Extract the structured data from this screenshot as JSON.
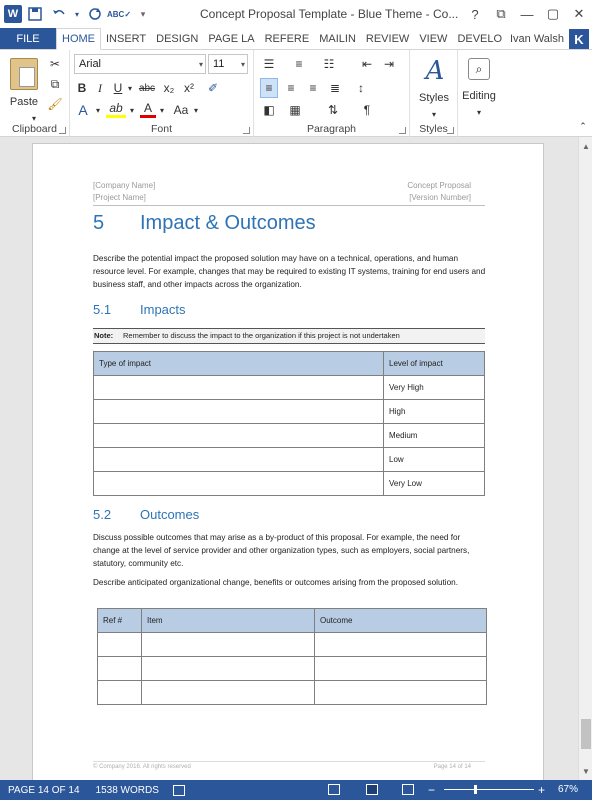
{
  "window": {
    "title": "Concept Proposal Template - Blue Theme - Co...",
    "help": "?",
    "restore": "▢",
    "minimize": "—",
    "close": "✕"
  },
  "qat": {
    "logo": "W",
    "save_icon": "save-icon",
    "undo_icon": "undo-icon",
    "redo_icon": "redo-icon",
    "spelling_icon": "spelling-icon",
    "customize_icon": "customize-icon"
  },
  "tabs": [
    "FILE",
    "HOME",
    "INSERT",
    "DESIGN",
    "PAGE LA",
    "REFERE",
    "MAILIN",
    "REVIEW",
    "VIEW",
    "DEVELO"
  ],
  "user": {
    "name": "Ivan Walsh",
    "initial": "K"
  },
  "ribbon": {
    "clipboard": {
      "label": "Clipboard",
      "paste": "Paste"
    },
    "font": {
      "label": "Font",
      "font_name": "Arial",
      "font_size": "11",
      "bold": "B",
      "italic": "I",
      "underline": "U",
      "strike": "abc",
      "subscript": "x₂",
      "superscript": "x²",
      "grow": "A",
      "case": "Aa",
      "highlight": "ab",
      "color": "A"
    },
    "paragraph": {
      "label": "Paragraph",
      "pilcrow": "¶"
    },
    "styles": {
      "label": "Styles",
      "button": "Styles"
    },
    "editing": {
      "button": "Editing"
    }
  },
  "document": {
    "header_left": [
      "[Company Name]",
      "[Project Name]"
    ],
    "header_right": [
      "Concept Proposal",
      "[Version Number]"
    ],
    "h1_num": "5",
    "h1_text": "Impact & Outcomes",
    "intro": "Describe the potential impact the proposed solution may have on a technical, operations, and human resource level. For example, changes that may be required to existing IT systems, training for end users and business staff, and other impacts across the organization.",
    "h2a_num": "5.1",
    "h2a_text": "Impacts",
    "note_label": "Note:",
    "note_text": "Remember to discuss the impact to the organization if this project is not undertaken",
    "impact_table": {
      "headers": [
        "Type of impact",
        "Level of impact"
      ],
      "rows": [
        [
          "",
          "Very High"
        ],
        [
          "",
          "High"
        ],
        [
          "",
          "Medium"
        ],
        [
          "",
          "Low"
        ],
        [
          "",
          "Very Low"
        ]
      ]
    },
    "h2b_num": "5.2",
    "h2b_text": "Outcomes",
    "outcomes_p1": "Discuss possible outcomes that may arise as a by-product of this proposal. For example, the need for change at the level of service provider and other organization types, such as employers, social partners, statutory, community etc.",
    "outcomes_p2": "Describe anticipated organizational change, benefits or outcomes arising from the proposed solution.",
    "outcome_table": {
      "headers": [
        "Ref #",
        "Item",
        "Outcome"
      ],
      "rows": [
        [
          "",
          "",
          ""
        ],
        [
          "",
          "",
          ""
        ],
        [
          "",
          "",
          ""
        ]
      ]
    },
    "footer_left": "© Company 2016. All rights reserved",
    "footer_right": "Page 14 of 14"
  },
  "status": {
    "page": "PAGE 14 OF 14",
    "words": "1538 WORDS",
    "zoom_minus": "−",
    "zoom_plus": "+",
    "zoom": "67%"
  }
}
